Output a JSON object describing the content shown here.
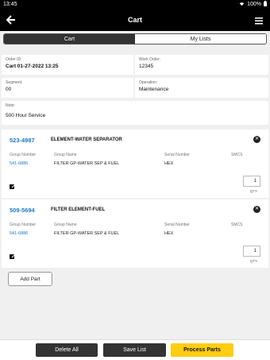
{
  "status_bar": {
    "time": "13:45",
    "battery": "100%"
  },
  "app_bar": {
    "title": "Cart"
  },
  "tabs": [
    {
      "label": "Cart",
      "active": true
    },
    {
      "label": "My Lists",
      "active": false
    }
  ],
  "order": {
    "order_id": {
      "label": "Order ID:",
      "value": "Cart 01-27-2022 13:25"
    },
    "work_order": {
      "label": "Work Order:",
      "value": "12345"
    },
    "segment": {
      "label": "Segment:",
      "value": "00"
    },
    "operation": {
      "label": "Operation:",
      "value": "Maintenance"
    },
    "note": {
      "label": "Note:",
      "value": "500 Hour Service"
    }
  },
  "columns": {
    "group_number": "Group Number",
    "group_name": "Group Name",
    "serial_number": "Serial Number",
    "smcs": "SMCS"
  },
  "parts": [
    {
      "part_number": "523-4987",
      "name": "ELEMENT-WATER SEPARATOR",
      "group_number": "541-6886",
      "group_name": "FILTER GP-WATER SEP & FUEL",
      "serial_number": "HEX",
      "smcs": "",
      "qty": "1",
      "qty_label": "QTY"
    },
    {
      "part_number": "509-5694",
      "name": "FILTER ELEMENT-FUEL",
      "group_number": "541-6886",
      "group_name": "FILTER GP-WATER SEP & FUEL",
      "serial_number": "HEX",
      "smcs": "",
      "qty": "1",
      "qty_label": "QTY"
    }
  ],
  "add_part_label": "Add Part",
  "bottom_bar": {
    "delete_all": "Delete All",
    "save_list": "Save List",
    "process_parts": "Process Parts"
  },
  "colors": {
    "accent": "#ffcd11",
    "link": "#1a7ac7",
    "header": "#000000"
  }
}
